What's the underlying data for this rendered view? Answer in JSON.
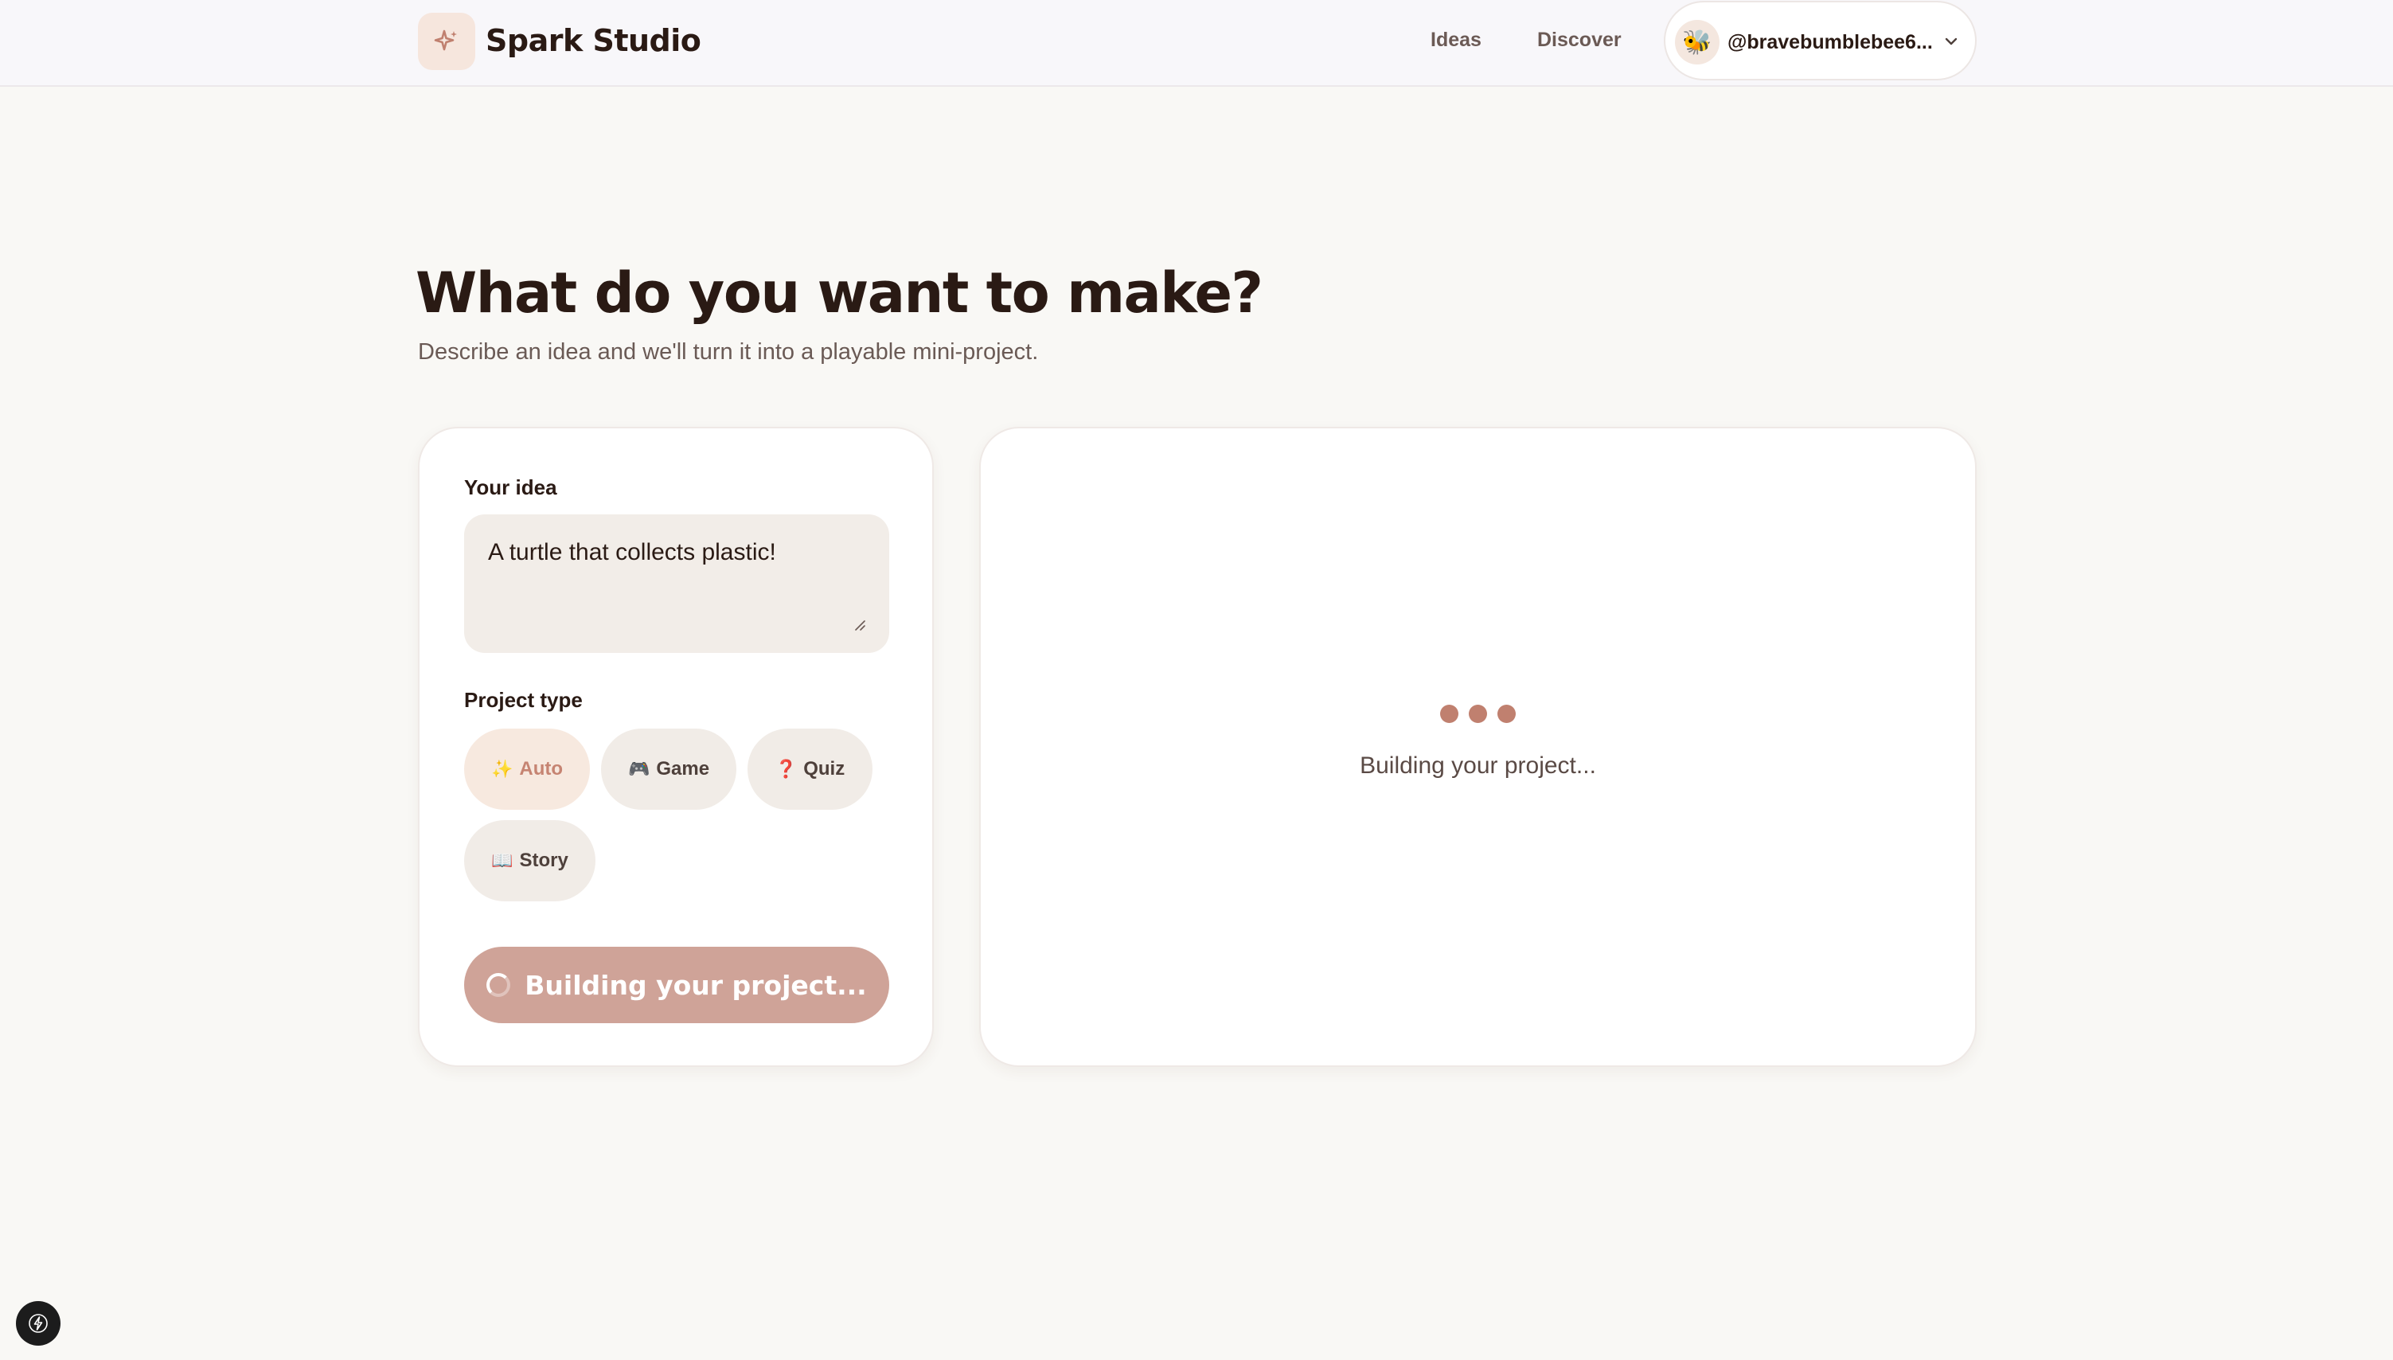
{
  "header": {
    "brand": "Spark Studio",
    "nav": {
      "ideas": "Ideas",
      "discover": "Discover"
    },
    "user": {
      "avatar": "🐝",
      "handle": "@bravebumblebee6..."
    }
  },
  "hero": {
    "title": "What do you want to make?",
    "subtitle": "Describe an idea and we'll turn it into a playable mini-project."
  },
  "form": {
    "idea_label": "Your idea",
    "idea_value": "A turtle that collects plastic!",
    "type_label": "Project type",
    "types": [
      {
        "emoji": "✨",
        "label": "Auto",
        "selected": true
      },
      {
        "emoji": "🎮",
        "label": "Game",
        "selected": false
      },
      {
        "emoji": "❓",
        "label": "Quiz",
        "selected": false
      },
      {
        "emoji": "📖",
        "label": "Story",
        "selected": false
      }
    ],
    "submit_label": "Building your project..."
  },
  "preview": {
    "loading_text": "Building your project..."
  },
  "colors": {
    "accent": "#c0806f",
    "button_disabled": "#cfa398",
    "chip_active_bg": "#f7e9df",
    "page_bg": "#f9f8f5"
  }
}
